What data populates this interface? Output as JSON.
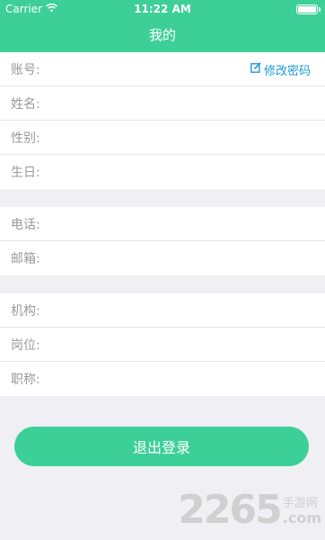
{
  "status": {
    "carrier": "Carrier",
    "time": "11:22 AM"
  },
  "header": {
    "title": "我的"
  },
  "profile": {
    "account_label": "账号:",
    "edit_password_label": "修改密码",
    "name_label": "姓名:",
    "gender_label": "性别:",
    "birthday_label": "生日:"
  },
  "contact": {
    "phone_label": "电话:",
    "email_label": "邮箱:"
  },
  "work": {
    "org_label": "机构:",
    "position_label": "岗位:",
    "title_label": "职称:"
  },
  "actions": {
    "logout_label": "退出登录"
  },
  "watermark": {
    "number": "2265",
    "site_cn": "手游网",
    "site_com": ".com"
  },
  "colors": {
    "accent": "#3dcf98",
    "link": "#1e9ad6",
    "background": "#efeff4"
  }
}
